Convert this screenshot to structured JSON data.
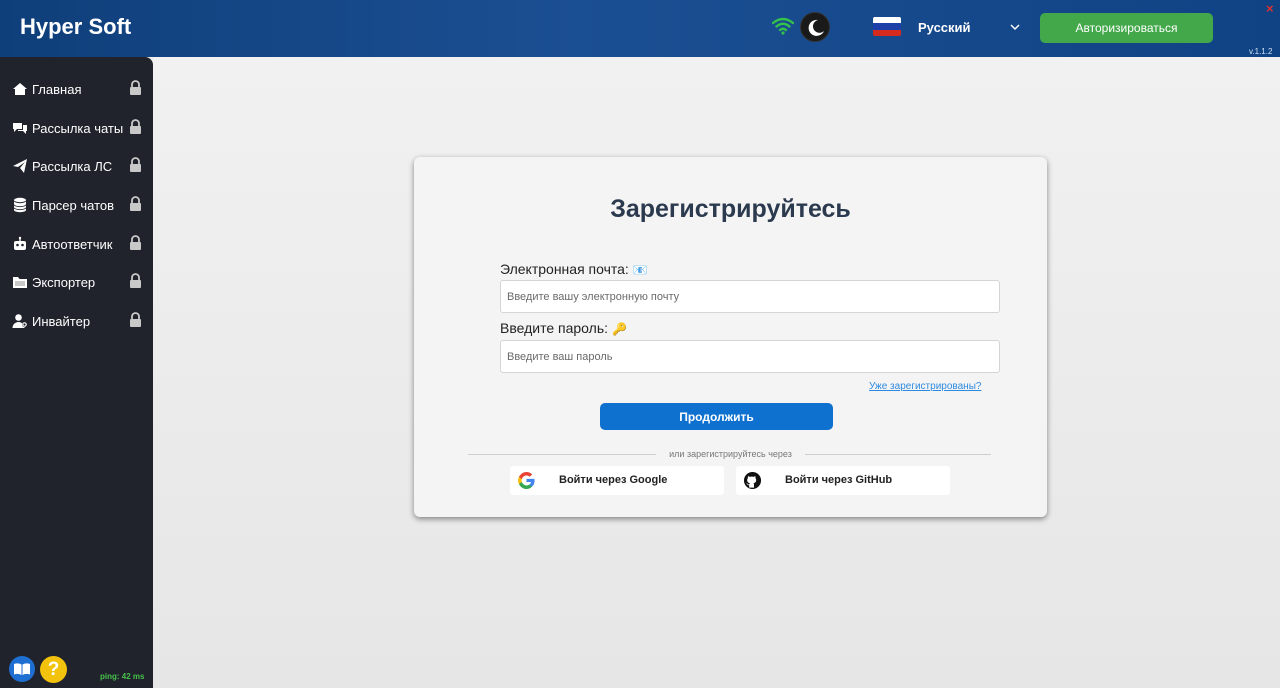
{
  "header": {
    "app_title": "Hyper Soft",
    "language": "Русский",
    "auth_button": "Авторизироваться",
    "close": "×",
    "version": "v.1.1.2",
    "colors": {
      "accent_green": "#43a84a",
      "wifi": "#35c24a"
    }
  },
  "sidebar": {
    "items": [
      {
        "label": "Главная",
        "icon": "home-icon"
      },
      {
        "label": "Рассылка чаты",
        "icon": "chat-icon"
      },
      {
        "label": "Рассылка ЛС",
        "icon": "paper-plane-icon"
      },
      {
        "label": "Парсер чатов",
        "icon": "database-icon"
      },
      {
        "label": "Автоответчик",
        "icon": "robot-icon"
      },
      {
        "label": "Экспортер",
        "icon": "folder-icon"
      },
      {
        "label": "Инвайтер",
        "icon": "user-cog-icon"
      }
    ],
    "help": "?",
    "ping": "ping: 42 ms"
  },
  "register_card": {
    "title": "Зарегистрируйтесь",
    "email_label": "Электронная почта:",
    "email_emoji": "📧",
    "email_placeholder": "Введите вашу электронную почту",
    "password_label": "Введите пароль:",
    "password_emoji": "🔑",
    "password_placeholder": "Введите ваш пароль",
    "already_registered": "Уже зарегистрированы?",
    "continue_button": "Продолжить",
    "or_register_via": "или зарегистрируйтесь через",
    "google_button": "Войти через Google",
    "github_button": "Войти через GitHub",
    "colors": {
      "primary_blue": "#0e71d0"
    }
  }
}
